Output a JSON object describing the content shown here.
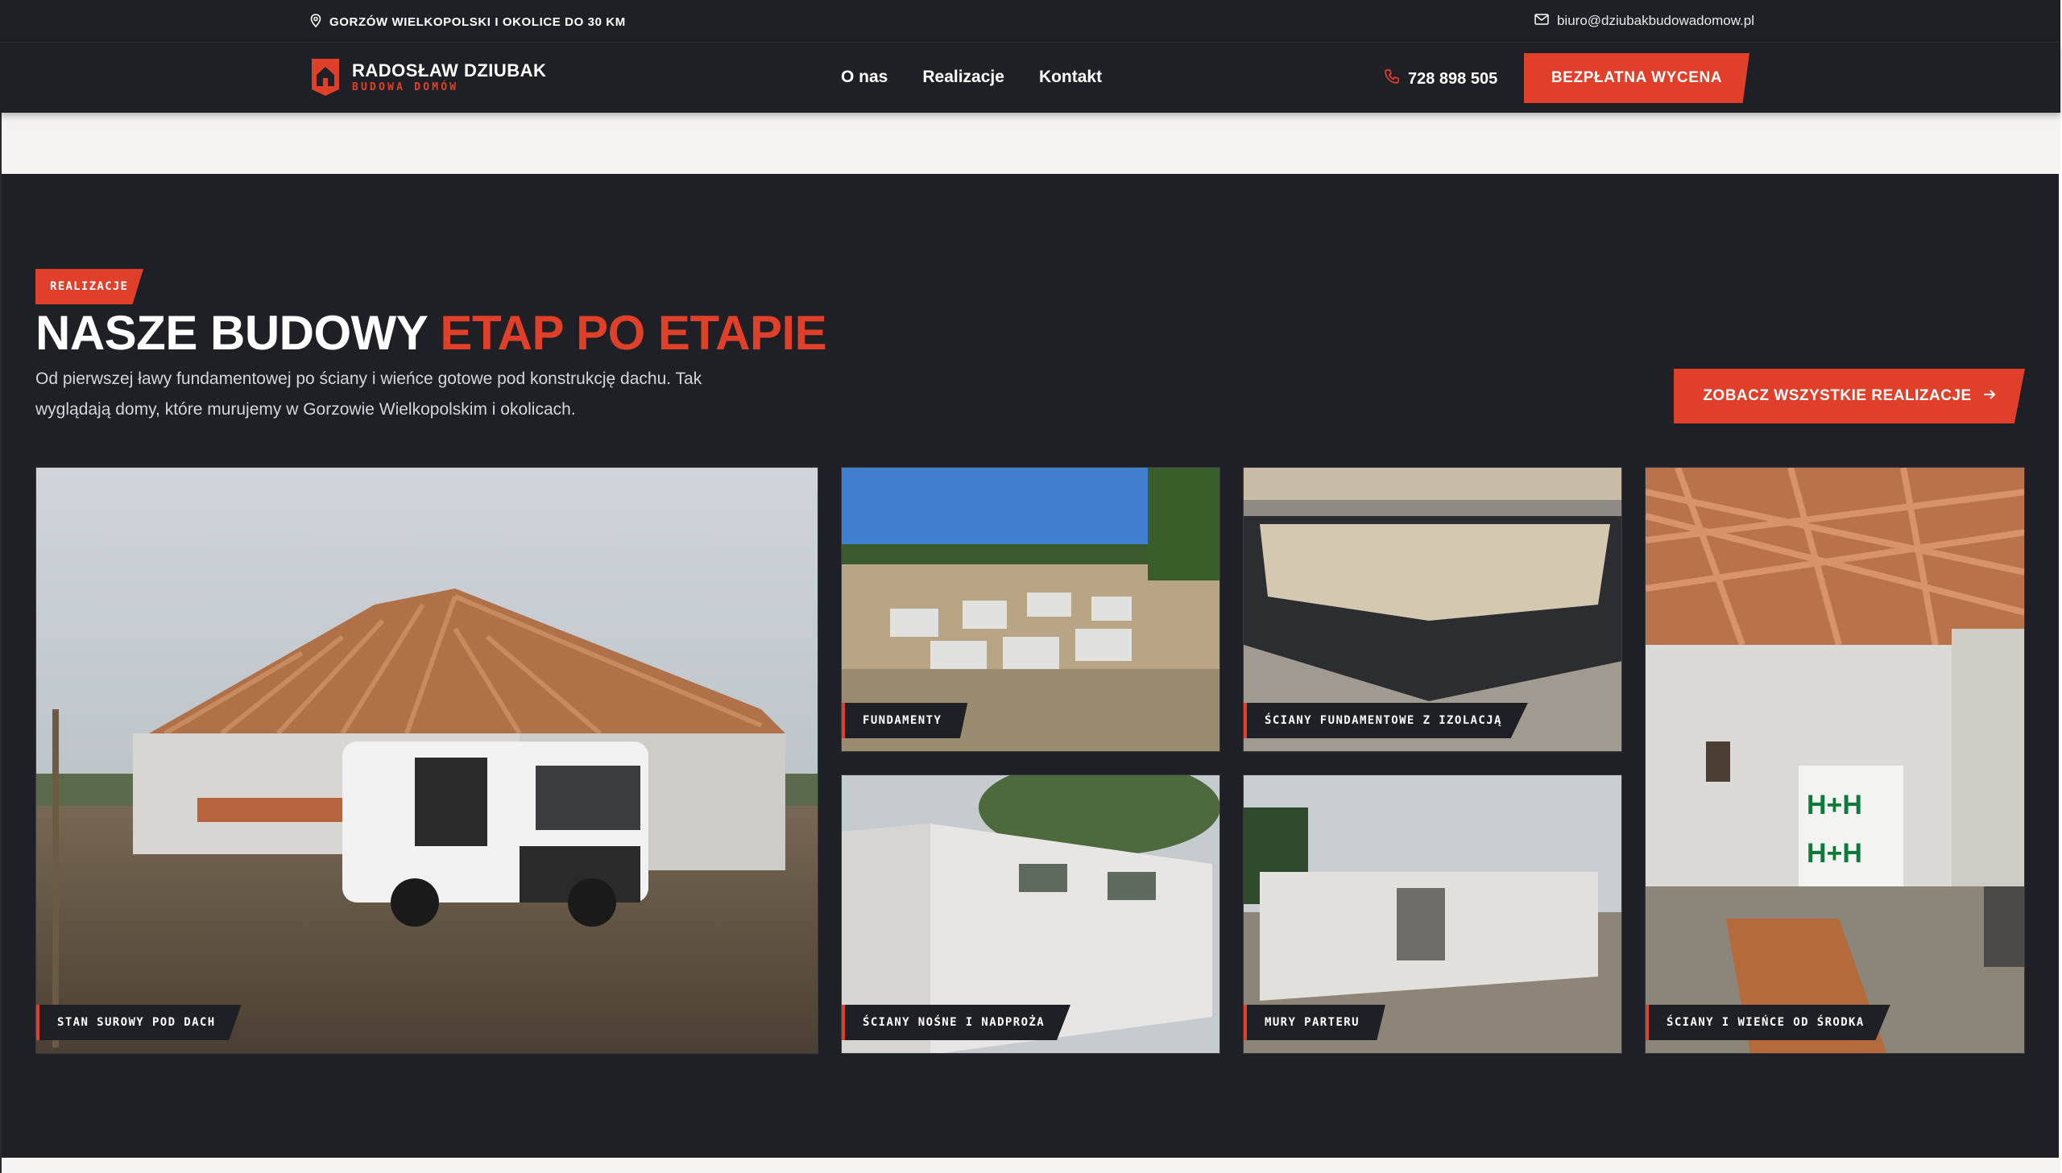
{
  "topbar": {
    "location": "GORZÓW WIELKOPOLSKI I OKOLICE DO 30 KM",
    "email": "biuro@dziubakbudowadomow.pl"
  },
  "brand": {
    "name": "RADOSŁAW DZIUBAK",
    "tagline": "BUDOWA DOMÓW",
    "accent": "#e0402a",
    "dark": "#1f2025"
  },
  "nav": {
    "items": [
      {
        "label": "O nas"
      },
      {
        "label": "Realizacje"
      },
      {
        "label": "Kontakt"
      }
    ],
    "phone": "728 898 505",
    "cta": "BEZPŁATNA WYCENA"
  },
  "section": {
    "badge": "REALIZACJE",
    "title_white": "NASZE BUDOWY",
    "title_accent": "ETAP PO ETAPIE",
    "lead": "Od pierwszej ławy fundamentowej po ściany i wieńce gotowe pod konstrukcję dachu. Tak wyglądają domy, które murujemy w Gorzowie Wielkopolskim i okolicach.",
    "cta": "ZOBACZ WSZYSTKIE REALIZACJE"
  },
  "gallery": [
    {
      "label": "STAN SUROWY POD DACH"
    },
    {
      "label": "FUNDAMENTY"
    },
    {
      "label": "ŚCIANY FUNDAMENTOWE Z IZOLACJĄ"
    },
    {
      "label": "ŚCIANY NOŚNE I NADPROŻA"
    },
    {
      "label": "MURY PARTERU"
    },
    {
      "label": "ŚCIANY I WIEŃCE OD ŚRODKA"
    }
  ]
}
